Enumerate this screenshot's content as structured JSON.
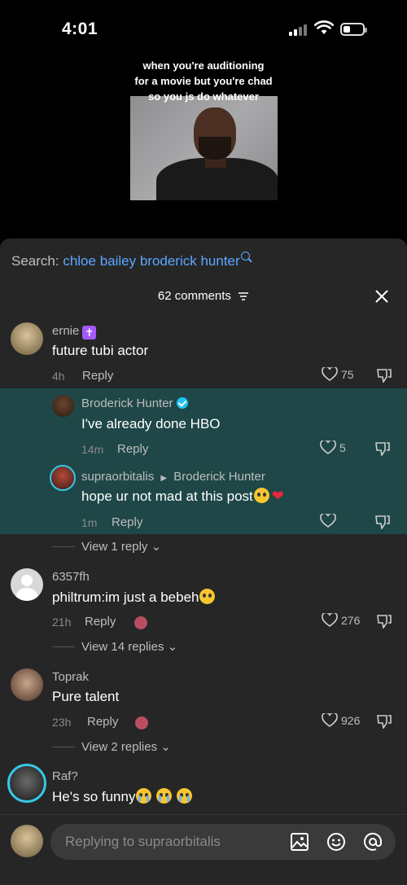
{
  "status_bar": {
    "time": "4:01"
  },
  "video": {
    "caption_lines": [
      "when you're auditioning",
      "for a movie but you're chad",
      "so you js do whatever"
    ]
  },
  "search": {
    "prefix": "Search:",
    "query": "chloe bailey broderick hunter"
  },
  "comments_header": {
    "count_label": "62 comments"
  },
  "comments": [
    {
      "username": "ernie",
      "badge": "✝",
      "text": "future tubi actor",
      "time": "4h",
      "reply_label": "Reply",
      "likes": "75"
    },
    {
      "username": "Broderick Hunter",
      "text": "I've already done HBO",
      "time": "14m",
      "reply_label": "Reply",
      "likes": "5"
    },
    {
      "username": "supraorbitalis",
      "reply_to": "Broderick Hunter",
      "text": "hope ur not mad at this post",
      "time": "1m",
      "reply_label": "Reply",
      "likes": ""
    },
    {
      "view_replies": "View 1 reply"
    },
    {
      "username": "6357fh",
      "text": "philtrum:im just a bebeh",
      "time": "21h",
      "reply_label": "Reply",
      "likes": "276",
      "view_replies": "View 14 replies"
    },
    {
      "username": "Toprak",
      "text": "Pure talent",
      "time": "23h",
      "reply_label": "Reply",
      "likes": "926",
      "view_replies": "View 2 replies"
    },
    {
      "username": "Raf?",
      "text": "He's so funny"
    }
  ],
  "composer": {
    "placeholder": "Replying to supraorbitalis"
  },
  "colors": {
    "accent_blue": "#5aa8ff",
    "highlight_bg": "#1f4747",
    "panel_bg": "#262626",
    "verified": "#20c4f4"
  }
}
